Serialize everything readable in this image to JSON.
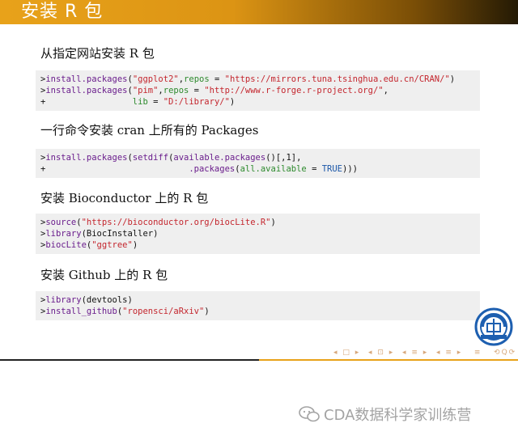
{
  "slide": {
    "title": "安装 R 包",
    "sections": [
      {
        "heading": "从指定网站安装 R 包",
        "lines": [
          [
            [
              ">",
              ""
            ],
            [
              "install.packages",
              "fn"
            ],
            [
              "(",
              ""
            ],
            [
              "\"ggplot2\"",
              "str"
            ],
            [
              ",",
              ""
            ],
            [
              "repos",
              "arg"
            ],
            [
              " = ",
              ""
            ],
            [
              "\"https://mirrors.tuna.tsinghua.edu.cn/CRAN/\"",
              "str"
            ],
            [
              ")",
              ""
            ]
          ],
          [
            [
              ">",
              ""
            ],
            [
              "install.packages",
              "fn"
            ],
            [
              "(",
              ""
            ],
            [
              "\"pim\"",
              "str"
            ],
            [
              ",",
              ""
            ],
            [
              "repos",
              "arg"
            ],
            [
              " = ",
              ""
            ],
            [
              "\"http://www.r-forge.r-project.org/\"",
              "str"
            ],
            [
              ",",
              ""
            ]
          ],
          [
            [
              "+                 ",
              ""
            ],
            [
              "lib",
              "arg"
            ],
            [
              " = ",
              ""
            ],
            [
              "\"D:/library/\"",
              "str"
            ],
            [
              ")",
              ""
            ]
          ]
        ]
      },
      {
        "heading": "一行命令安装 cran 上所有的 Packages",
        "lines": [
          [
            [
              ">",
              ""
            ],
            [
              "install.packages",
              "fn"
            ],
            [
              "(",
              ""
            ],
            [
              "setdiff",
              "fn"
            ],
            [
              "(",
              ""
            ],
            [
              "available.packages",
              "fn"
            ],
            [
              "()[,1],",
              ""
            ]
          ],
          [
            [
              "+                            ",
              ""
            ],
            [
              ".packages",
              "fn"
            ],
            [
              "(",
              ""
            ],
            [
              "all.available",
              "arg"
            ],
            [
              " = ",
              ""
            ],
            [
              "TRUE",
              "kw"
            ],
            [
              ")))",
              ""
            ]
          ]
        ]
      },
      {
        "heading": "安装 Bioconductor 上的 R 包",
        "lines": [
          [
            [
              ">",
              ""
            ],
            [
              "source",
              "fn"
            ],
            [
              "(",
              ""
            ],
            [
              "\"https://bioconductor.org/biocLite.R\"",
              "str"
            ],
            [
              ")",
              ""
            ]
          ],
          [
            [
              ">",
              ""
            ],
            [
              "library",
              "fn"
            ],
            [
              "(BiocInstaller)",
              ""
            ]
          ],
          [
            [
              ">",
              ""
            ],
            [
              "biocLite",
              "fn"
            ],
            [
              "(",
              ""
            ],
            [
              "\"ggtree\"",
              "str"
            ],
            [
              ")",
              ""
            ]
          ]
        ]
      },
      {
        "heading": "安装 Github 上的 R 包",
        "lines": [
          [
            [
              ">",
              ""
            ],
            [
              "library",
              "fn"
            ],
            [
              "(devtools)",
              ""
            ]
          ],
          [
            [
              ">",
              ""
            ],
            [
              "install_github",
              "fn"
            ],
            [
              "(",
              ""
            ],
            [
              "\"ropensci/aRxiv\"",
              "str"
            ],
            [
              ")",
              ""
            ]
          ]
        ]
      }
    ],
    "nav_symbols": "◂ □ ▸  ◂ ⊡ ▸  ◂ ≡ ▸  ◂ ≡ ▸   ≡   ⟲Q⟳"
  },
  "watermark": "CDA数据科学家训练营",
  "colors": {
    "title_bar_start": "#e8a21a",
    "title_bar_end": "#241a05",
    "code_bg": "#efefef",
    "function": "#6a1d8c",
    "string": "#c4262e",
    "argument": "#2d8a2d",
    "keyword": "#1a56a8"
  }
}
